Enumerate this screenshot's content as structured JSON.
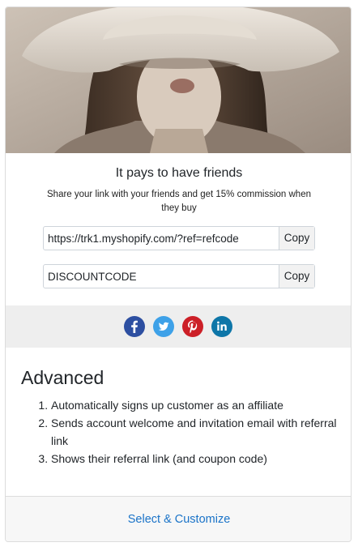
{
  "promo": {
    "title": "It pays to have friends",
    "subtitle": "Share your link with your friends and get 15% commission when they buy",
    "link_value": "https://trk1.myshopify.com/?ref=refcode",
    "coupon_value": "DISCOUNTCODE",
    "copy_label": "Copy"
  },
  "social": [
    {
      "name": "facebook",
      "icon": "facebook-icon",
      "color": "#2d4fa1"
    },
    {
      "name": "twitter",
      "icon": "twitter-icon",
      "color": "#3ea1e8"
    },
    {
      "name": "pinterest",
      "icon": "pinterest-icon",
      "color": "#cc1f27"
    },
    {
      "name": "linkedin",
      "icon": "linkedin-icon",
      "color": "#0e76a8"
    }
  ],
  "advanced": {
    "title": "Advanced",
    "items": [
      "Automatically signs up customer as an affiliate",
      "Sends account welcome and invitation email with referral link",
      "Shows their referral link (and coupon code)"
    ]
  },
  "footer": {
    "action_label": "Select & Customize",
    "link_color": "#1a73c8"
  }
}
